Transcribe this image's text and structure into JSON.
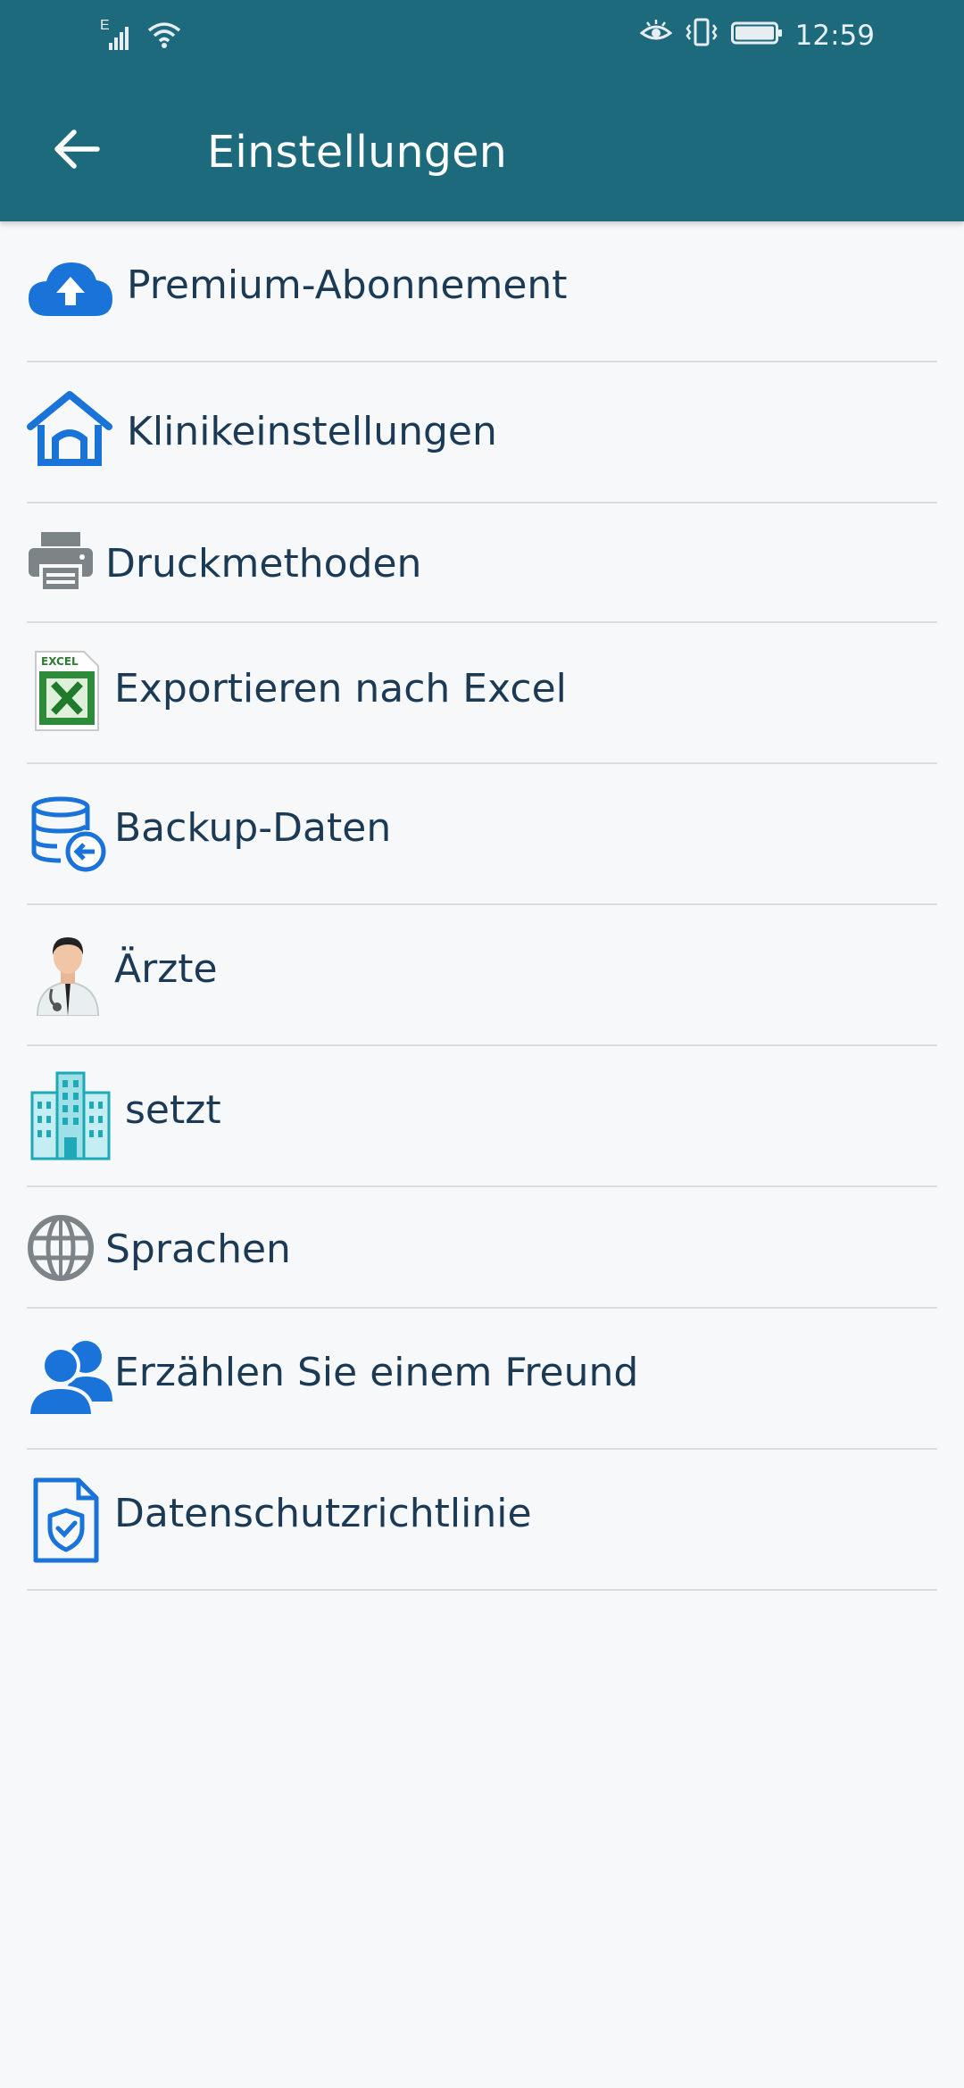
{
  "status_bar": {
    "network_type": "E",
    "time": "12:59"
  },
  "header": {
    "title": "Einstellungen",
    "back_icon": "arrow-left-icon"
  },
  "settings": {
    "items": [
      {
        "label": "Premium-Abonnement",
        "icon": "cloud-upload-icon"
      },
      {
        "label": "Klinikeinstellungen",
        "icon": "home-icon"
      },
      {
        "label": "Druckmethoden",
        "icon": "printer-icon"
      },
      {
        "label": "Exportieren nach Excel",
        "icon": "excel-icon",
        "icon_text": "EXCEL"
      },
      {
        "label": "Backup-Daten",
        "icon": "database-backup-icon"
      },
      {
        "label": "Ärzte",
        "icon": "doctor-icon"
      },
      {
        "label": "setzt",
        "icon": "building-icon"
      },
      {
        "label": "Sprachen",
        "icon": "globe-icon"
      },
      {
        "label": "Erzählen Sie einem Freund",
        "icon": "users-icon"
      },
      {
        "label": "Datenschutzrichtlinie",
        "icon": "shield-document-icon"
      }
    ]
  },
  "colors": {
    "appbar": "#1e6a7d",
    "background": "#f7f8f9",
    "text": "#1b3a55",
    "icon_blue": "#1a73d9",
    "divider": "#dcdcdc"
  }
}
